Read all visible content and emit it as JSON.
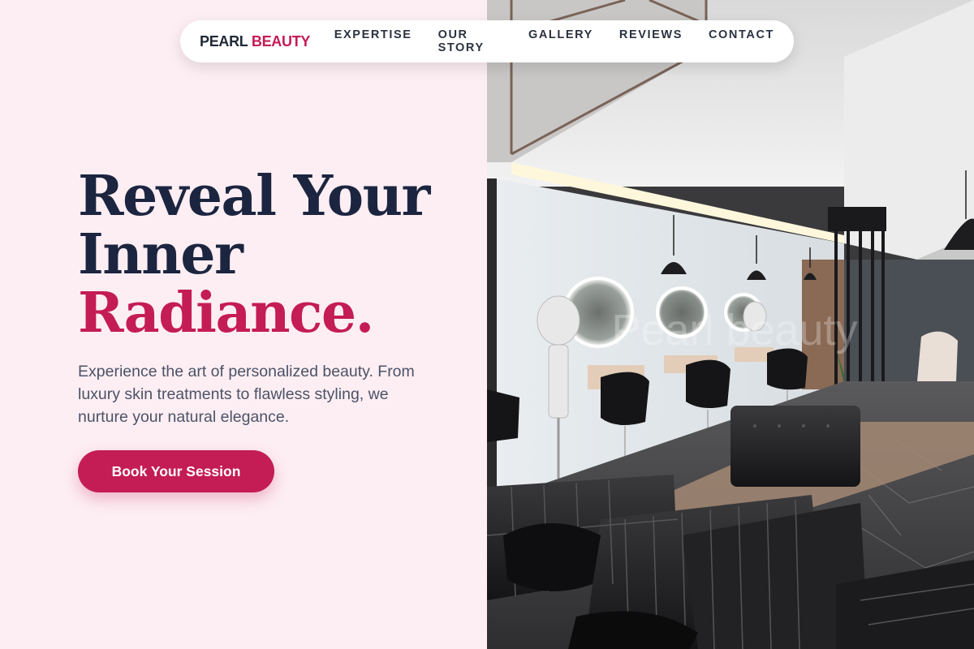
{
  "nav": {
    "brand_part1": "PEARL",
    "brand_part2": "BEAUTY",
    "links": [
      "EXPERTISE",
      "OUR STORY",
      "GALLERY",
      "REVIEWS",
      "CONTACT"
    ]
  },
  "hero": {
    "title_line1": "Reveal Your",
    "title_line2": "Inner",
    "title_line3": "Radiance.",
    "subtitle": "Experience the art of personalized beauty. From luxury skin treatments to flawless styling, we nurture your natural elegance.",
    "cta_label": "Book Your Session"
  },
  "image": {
    "description_name": "salon-interior-photo",
    "watermark": "Pearl beauty"
  },
  "colors": {
    "background": "#fdeef3",
    "accent": "#c41c55",
    "heading": "#1c2540",
    "body_text": "#4b5366"
  }
}
